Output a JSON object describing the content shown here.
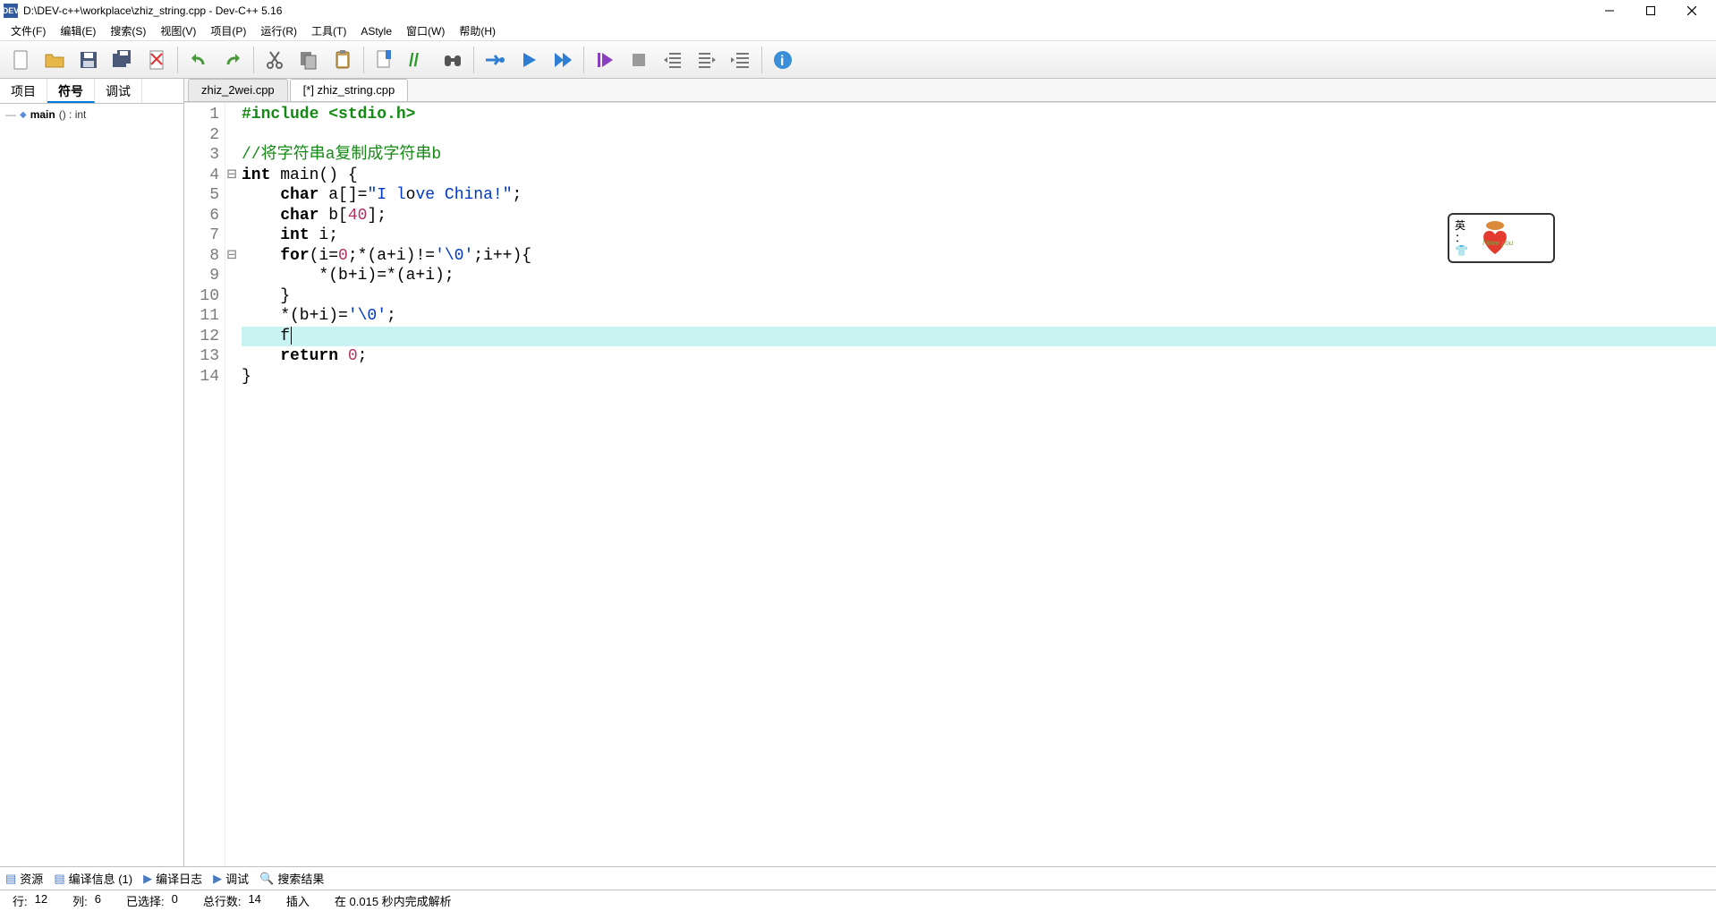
{
  "title": "D:\\DEV-c++\\workplace\\zhiz_string.cpp - Dev-C++ 5.16",
  "app_icon_text": "DEV",
  "menu": [
    "文件(F)",
    "编辑(E)",
    "搜索(S)",
    "视图(V)",
    "项目(P)",
    "运行(R)",
    "工具(T)",
    "AStyle",
    "窗口(W)",
    "帮助(H)"
  ],
  "toolbar": [
    {
      "name": "new-file-icon",
      "title": "New",
      "svg": "doc"
    },
    {
      "name": "open-file-icon",
      "title": "Open",
      "svg": "folder"
    },
    {
      "name": "save-icon",
      "title": "Save",
      "svg": "floppy"
    },
    {
      "name": "save-all-icon",
      "title": "Save All",
      "svg": "floppy2"
    },
    {
      "name": "close-file-icon",
      "title": "Close",
      "svg": "docx"
    },
    {
      "sep": true
    },
    {
      "name": "undo-icon",
      "title": "Undo",
      "svg": "undo"
    },
    {
      "name": "redo-icon",
      "title": "Redo",
      "svg": "redo"
    },
    {
      "sep": true
    },
    {
      "name": "cut-icon",
      "title": "Cut",
      "svg": "cut"
    },
    {
      "name": "copy-icon",
      "title": "Copy",
      "svg": "copy"
    },
    {
      "name": "paste-icon",
      "title": "Paste",
      "svg": "paste"
    },
    {
      "sep": true
    },
    {
      "name": "bookmark-icon",
      "title": "Bookmark",
      "svg": "bmk"
    },
    {
      "name": "comment-icon",
      "title": "Comment",
      "svg": "slash"
    },
    {
      "name": "find-icon",
      "title": "Find",
      "svg": "binoc"
    },
    {
      "sep": true
    },
    {
      "name": "compile-icon",
      "title": "Compile",
      "svg": "gear-run"
    },
    {
      "name": "run-icon",
      "title": "Run",
      "svg": "play"
    },
    {
      "name": "compile-run-icon",
      "title": "Compile&Run",
      "svg": "play2"
    },
    {
      "sep": true
    },
    {
      "name": "debug-icon",
      "title": "Debug",
      "svg": "play-bar"
    },
    {
      "name": "stop-icon",
      "title": "Stop",
      "svg": "stop"
    },
    {
      "name": "indent-less-icon",
      "title": "Unindent",
      "svg": "ind-l"
    },
    {
      "name": "indent-more-icon",
      "title": "Indent",
      "svg": "ind-r"
    },
    {
      "name": "indent-icon",
      "title": "Indent2",
      "svg": "ind-r2"
    },
    {
      "sep": true
    },
    {
      "name": "about-icon",
      "title": "About",
      "svg": "info"
    }
  ],
  "left_tabs": {
    "items": [
      "项目",
      "符号",
      "调试"
    ],
    "active": 1
  },
  "tree": {
    "main_label": "main",
    "main_sig": "() : int"
  },
  "file_tabs": {
    "items": [
      "zhiz_2wei.cpp",
      "[*] zhiz_string.cpp"
    ],
    "active": 1
  },
  "code": {
    "current_line": 12,
    "lines": [
      {
        "n": 1,
        "fold": "",
        "raw": "#include <stdio.h>",
        "cls": "pp"
      },
      {
        "n": 2,
        "fold": "",
        "raw": ""
      },
      {
        "n": 3,
        "fold": "",
        "raw": "//将字符串a复制成字符串b",
        "cls": "cm"
      },
      {
        "n": 4,
        "fold": "⊟",
        "tokens": [
          [
            "kw",
            "int"
          ],
          [
            "id",
            " main() {"
          ]
        ]
      },
      {
        "n": 5,
        "fold": "",
        "tokens": [
          [
            "id",
            "    "
          ],
          [
            "kw",
            "char"
          ],
          [
            "id",
            " a[]="
          ],
          [
            "str",
            "\"I l"
          ],
          [
            "id",
            "o"
          ],
          [
            "str",
            "ve China!\""
          ],
          [
            "id",
            ";"
          ]
        ],
        "ibeam_after_segment": 4
      },
      {
        "n": 6,
        "fold": "",
        "tokens": [
          [
            "id",
            "    "
          ],
          [
            "kw",
            "char"
          ],
          [
            "id",
            " b["
          ],
          [
            "num",
            "40"
          ],
          [
            "id",
            "];"
          ]
        ]
      },
      {
        "n": 7,
        "fold": "",
        "tokens": [
          [
            "id",
            "    "
          ],
          [
            "kw",
            "int"
          ],
          [
            "id",
            " i;"
          ]
        ]
      },
      {
        "n": 8,
        "fold": "⊟",
        "tokens": [
          [
            "id",
            "    "
          ],
          [
            "kw",
            "for"
          ],
          [
            "id",
            "(i="
          ],
          [
            "num",
            "0"
          ],
          [
            "id",
            ";*(a+i)!="
          ],
          [
            "str",
            "'\\0'"
          ],
          [
            "id",
            ";i++){"
          ]
        ]
      },
      {
        "n": 9,
        "fold": "",
        "tokens": [
          [
            "id",
            "        *(b+i)=*(a+i);"
          ]
        ]
      },
      {
        "n": 10,
        "fold": "",
        "tokens": [
          [
            "id",
            "    }"
          ]
        ]
      },
      {
        "n": 11,
        "fold": "",
        "tokens": [
          [
            "id",
            "    *(b+i)="
          ],
          [
            "str",
            "'\\0'"
          ],
          [
            "id",
            ";"
          ]
        ]
      },
      {
        "n": 12,
        "fold": "",
        "tokens": [
          [
            "id",
            "    f"
          ]
        ],
        "caret_after": true
      },
      {
        "n": 13,
        "fold": "",
        "tokens": [
          [
            "id",
            "    "
          ],
          [
            "kw",
            "return"
          ],
          [
            "id",
            " "
          ],
          [
            "num",
            "0"
          ],
          [
            "id",
            ";"
          ]
        ]
      },
      {
        "n": 14,
        "fold": "",
        "tokens": [
          [
            "id",
            "}"
          ]
        ]
      }
    ]
  },
  "ime": {
    "lang": "英",
    "sep": "：",
    "hint_icon": "👕",
    "caption": "I love you"
  },
  "bottom_tabs": [
    {
      "icon": "▤",
      "label": "资源"
    },
    {
      "icon": "▤",
      "label": "编译信息 (1)"
    },
    {
      "icon": "▶",
      "label": "编译日志"
    },
    {
      "icon": "▶",
      "label": "调试"
    },
    {
      "icon": "🔍",
      "label": "搜索结果"
    }
  ],
  "status": {
    "row_label": "行:",
    "row": "12",
    "col_label": "列:",
    "col": "6",
    "sel_label": "已选择:",
    "sel": "0",
    "total_label": "总行数:",
    "total": "14",
    "mode": "插入",
    "parse": "在 0.015 秒内完成解析"
  }
}
